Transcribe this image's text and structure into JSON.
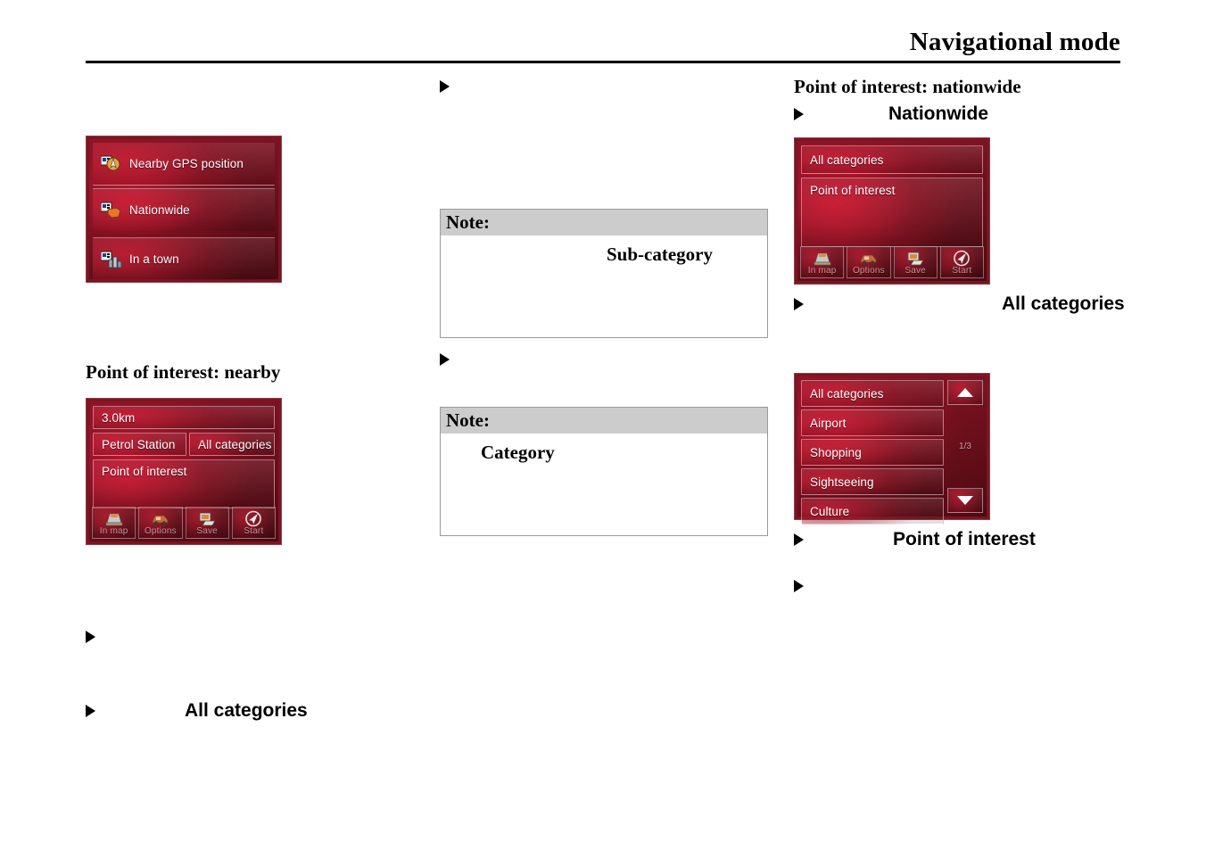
{
  "header": {
    "title": "Navigational mode"
  },
  "left_column": {
    "menu_device": {
      "items": [
        {
          "label": "Nearby GPS position",
          "icon": "gps-position-icon"
        },
        {
          "label": "Nationwide",
          "icon": "nationwide-map-icon"
        },
        {
          "label": "In a town",
          "icon": "in-a-town-icon"
        }
      ]
    },
    "heading_nearby": "Point of interest: nearby",
    "nearby_device": {
      "distance": "3.0km",
      "category": "Petrol Station",
      "all_categories": "All categories",
      "poi_field": "Point of interest",
      "toolbar": [
        {
          "label": "In map",
          "icon": "in-map-icon"
        },
        {
          "label": "Options",
          "icon": "options-icon"
        },
        {
          "label": "Save",
          "icon": "save-icon"
        },
        {
          "label": "Start",
          "icon": "start-icon"
        }
      ]
    },
    "bullets": [
      {
        "text": ""
      },
      {
        "text": "All  categories"
      }
    ]
  },
  "middle_column": {
    "bullets": [
      {
        "text": ""
      },
      {
        "text": ""
      }
    ],
    "notes": [
      {
        "title": "Note:",
        "body": "Sub-category"
      },
      {
        "title": "Note:",
        "body": "Category"
      }
    ]
  },
  "right_column": {
    "heading_nationwide": "Point of interest: nationwide",
    "bullet_nationwide": "Nationwide",
    "nationwide_device": {
      "all_categories": "All categories",
      "poi_field": "Point of interest",
      "toolbar": [
        {
          "label": "In map",
          "icon": "in-map-icon"
        },
        {
          "label": "Options",
          "icon": "options-icon"
        },
        {
          "label": "Save",
          "icon": "save-icon"
        },
        {
          "label": "Start",
          "icon": "start-icon"
        }
      ]
    },
    "bullet_all_categories": "All  categories",
    "category_list_device": {
      "items": [
        "All categories",
        "Airport",
        "Shopping",
        "Sightseeing",
        "Culture"
      ],
      "page_indicator": "1/3",
      "scroll_up_icon": "triangle-up-icon",
      "scroll_down_icon": "triangle-down-icon"
    },
    "bullet_point_of_interest": "Point of interest",
    "bullet_last": ""
  }
}
